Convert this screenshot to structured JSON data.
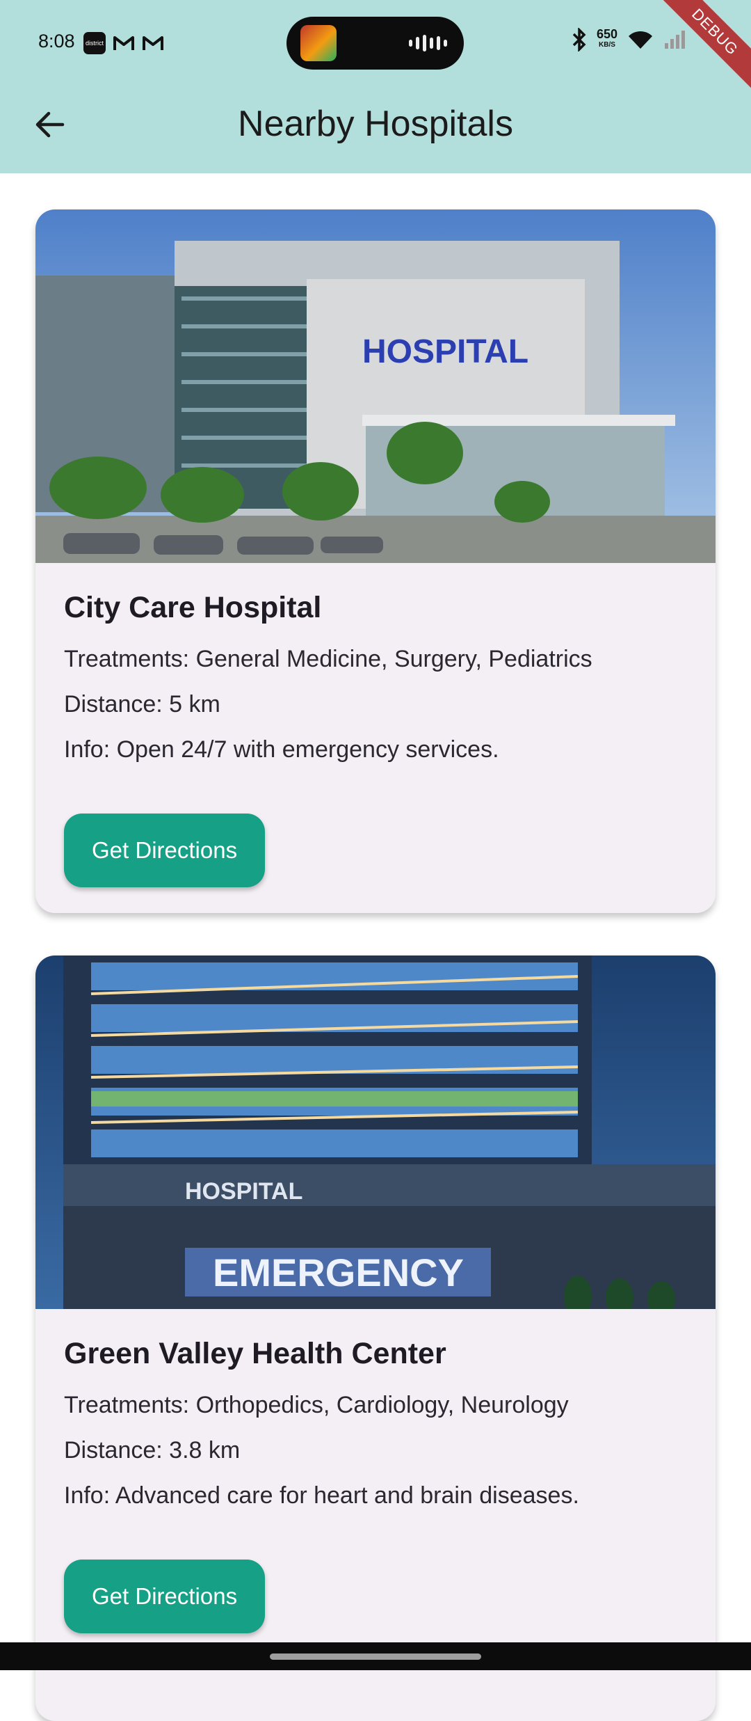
{
  "status_bar": {
    "time": "8:08",
    "app_icon_text": "district",
    "speed_value": "650",
    "speed_unit": "KB/S",
    "debug_label": "DEBUG"
  },
  "app_bar": {
    "title": "Nearby Hospitals",
    "back_icon": "arrow-left-icon",
    "background_color": "#b2dfdb"
  },
  "hospitals": [
    {
      "name": "City Care Hospital",
      "treatments": "Treatments: General Medicine, Surgery, Pediatrics",
      "distance": "Distance: 5 km",
      "info": "Info: Open 24/7 with emergency services.",
      "button_label": "Get Directions",
      "image_sign": "HOSPITAL"
    },
    {
      "name": "Green Valley Health Center",
      "treatments": "Treatments: Orthopedics, Cardiology, Neurology",
      "distance": "Distance: 3.8 km",
      "info": "Info: Advanced care for heart and brain diseases.",
      "button_label": "Get Directions",
      "image_sign_top": "HOSPITAL",
      "image_sign_main": "EMERGENCY"
    }
  ],
  "colors": {
    "accent": "#16a085",
    "card_background": "#f4eff5"
  }
}
